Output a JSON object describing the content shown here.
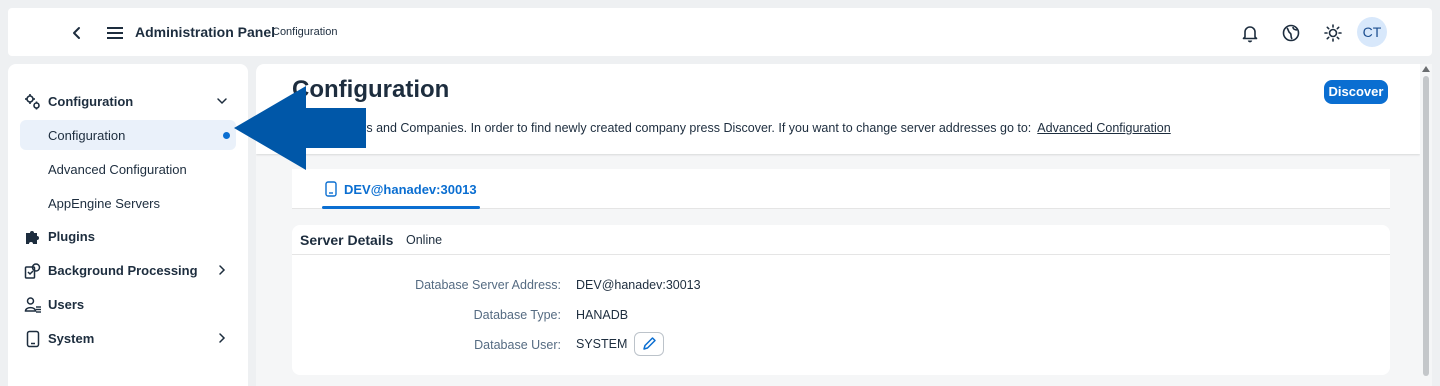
{
  "shellbar": {
    "back_icon": "chevron-left-icon",
    "menu_icon": "hamburger-menu-icon",
    "title": "Administration Panel",
    "subtitle": "Configuration",
    "icons": [
      "bell-icon",
      "globe-icon",
      "sun-icon"
    ],
    "avatar_initials": "CT"
  },
  "sidebar": {
    "items": [
      {
        "label": "Configuration",
        "icon": "gears-icon",
        "expanded": true,
        "children": [
          {
            "label": "Configuration",
            "selected": true
          },
          {
            "label": "Advanced Configuration"
          },
          {
            "label": "AppEngine Servers"
          }
        ]
      },
      {
        "label": "Plugins",
        "icon": "puzzle-icon"
      },
      {
        "label": "Background Processing",
        "icon": "process-icon",
        "has_children": true
      },
      {
        "label": "Users",
        "icon": "users-icon"
      },
      {
        "label": "System",
        "icon": "phone-icon",
        "has_children": true
      }
    ]
  },
  "main": {
    "title": "Configuration",
    "discover_label": "Discover",
    "description": "abase Servers and Companies. In order to find newly created company press Discover. If you want to change server addresses go to:",
    "advanced_link": "Advanced Configuration",
    "tab": {
      "label": "DEV@hanadev:30013",
      "icon": "phone-icon"
    },
    "details": {
      "title": "Server Details",
      "status": "Online",
      "rows": [
        {
          "label": "Database Server Address:",
          "value": "DEV@hanadev:30013"
        },
        {
          "label": "Database Type:",
          "value": "HANADB"
        },
        {
          "label": "Database User:",
          "value": "SYSTEM"
        }
      ],
      "edit_icon": "pencil-icon"
    }
  },
  "colors": {
    "accent": "#0a6ed1",
    "annotation_arrow": "#0057a8"
  }
}
